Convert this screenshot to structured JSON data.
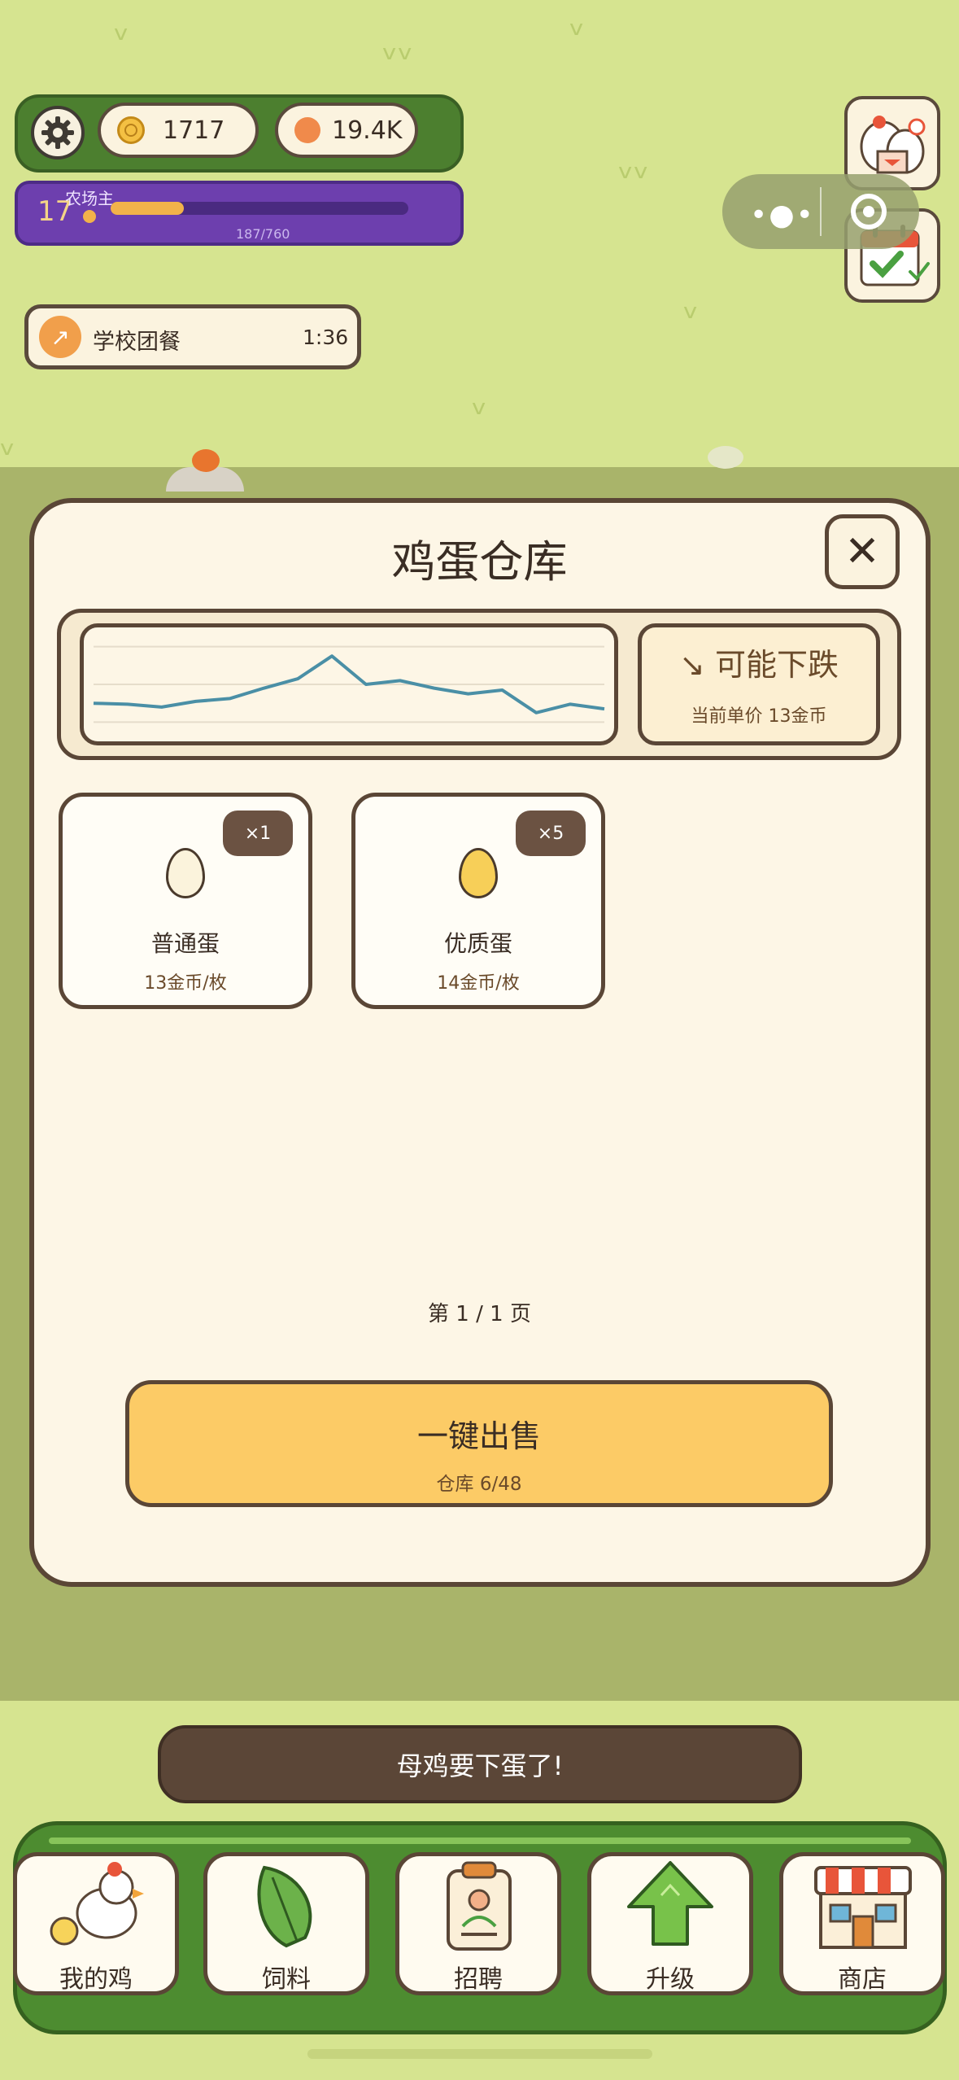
{
  "hud": {
    "coins": "1717",
    "points": "19.4K",
    "level": "17",
    "level_title": "农场主",
    "xp_text": "187/760",
    "xp_fraction": 0.246
  },
  "task": {
    "label": "学校团餐",
    "time": "1:36",
    "icon": "arrow-up-right-icon"
  },
  "modal": {
    "title": "鸡蛋仓库",
    "close_symbol": "✕",
    "trend": {
      "label": "↘ 可能下跌",
      "sub": "当前单价 13金币"
    },
    "items": [
      {
        "name": "普通蛋",
        "price": "13金币/枚",
        "count": "×1",
        "egg_color": "#fbf3dc"
      },
      {
        "name": "优质蛋",
        "price": "14金币/枚",
        "count": "×5",
        "egg_color": "#f7cf58"
      }
    ],
    "page_indicator": "第 1 / 1 页",
    "sell": {
      "label": "一键出售",
      "sub": "仓库 6/48"
    }
  },
  "chart_data": {
    "type": "line",
    "title": "",
    "xlabel": "",
    "ylabel": "",
    "x": [
      1,
      2,
      3,
      4,
      5,
      6,
      7,
      8,
      9,
      10,
      11,
      12,
      13,
      14,
      15,
      16
    ],
    "series": [
      {
        "values": [
          13.0,
          12.95,
          12.8,
          13.1,
          13.25,
          13.8,
          14.3,
          15.5,
          14.0,
          14.2,
          13.8,
          13.5,
          13.7,
          12.5,
          12.95,
          12.7
        ]
      }
    ],
    "ylim": [
      11.5,
      16.5
    ],
    "grid": true,
    "line_color": "#4a8fa6"
  },
  "toast": "母鸡要下蛋了!",
  "nav": [
    {
      "label": "我的鸡",
      "icon": "chicken-icon"
    },
    {
      "label": "饲料",
      "icon": "leaf-icon"
    },
    {
      "label": "招聘",
      "icon": "badge-icon"
    },
    {
      "label": "升级",
      "icon": "arrow-up-icon"
    },
    {
      "label": "商店",
      "icon": "store-icon"
    }
  ]
}
